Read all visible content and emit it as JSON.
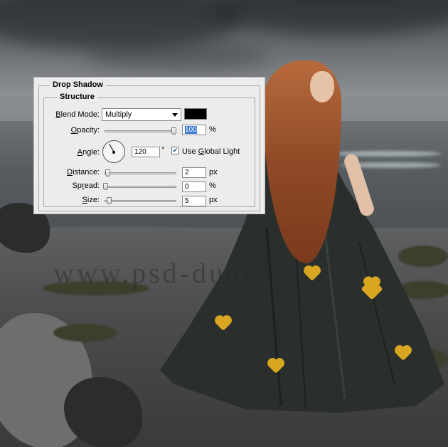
{
  "dialog": {
    "title": "Drop Shadow",
    "section": "Structure",
    "blend_mode": {
      "label_pre": "",
      "label_u": "B",
      "label_post": "lend Mode:",
      "value": "Multiply"
    },
    "shadow_color": "#000000",
    "opacity": {
      "label_u": "O",
      "label_post": "pacity:",
      "value": "100",
      "unit": "%",
      "level": 1.0
    },
    "angle": {
      "label_pre": "",
      "label_u": "A",
      "label_post": "ngle:",
      "value": "120",
      "unit": "°"
    },
    "global_light": {
      "label_pre": "Use ",
      "label_u": "G",
      "label_post": "lobal Light",
      "checked": true
    },
    "distance": {
      "label_u": "D",
      "label_post": "istance:",
      "value": "2",
      "unit": "px",
      "level": 0.0
    },
    "spread": {
      "label_pre": "Sp",
      "label_u": "r",
      "label_post": "ead:",
      "value": "0",
      "unit": "%",
      "level": 0.0
    },
    "size": {
      "label_u": "S",
      "label_post": "ize:",
      "value": "5",
      "unit": "px",
      "level": 0.02
    }
  },
  "background": {
    "watermark": "www.psd-dude"
  }
}
